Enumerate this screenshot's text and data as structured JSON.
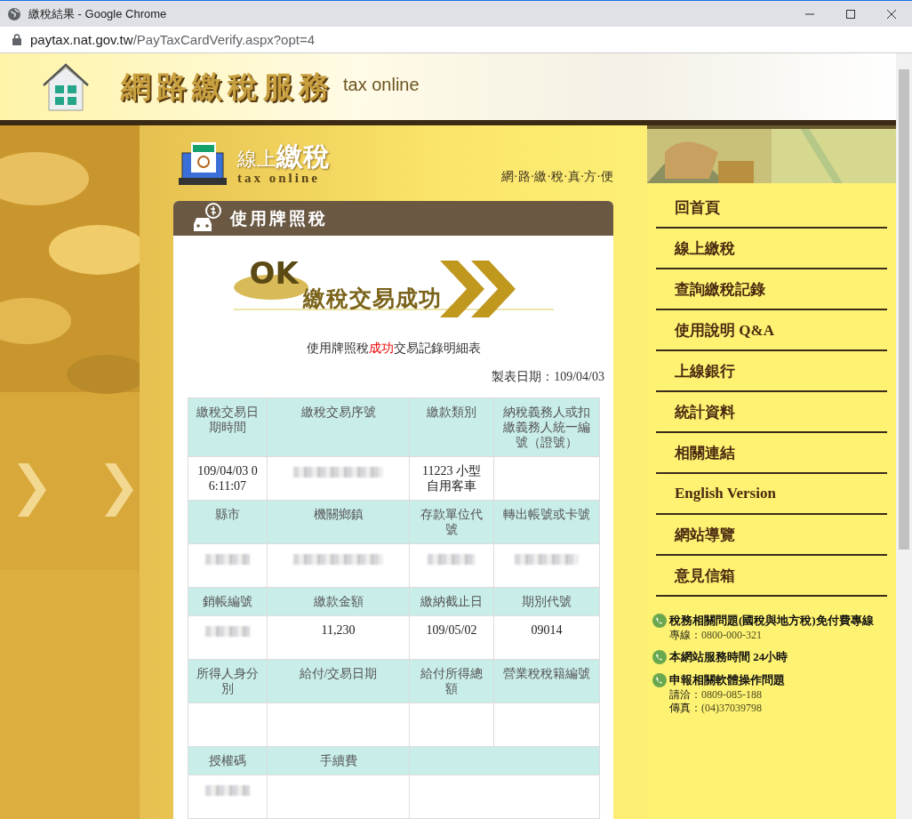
{
  "window": {
    "title": "繳稅結果 - Google Chrome",
    "url_host": "paytax.nat.gov.tw",
    "url_path": "/PayTaxCardVerify.aspx?opt=4"
  },
  "header": {
    "title": "網路繳稅服務",
    "subtitle": "tax online"
  },
  "section": {
    "title_small": "線上",
    "title_large": "繳稅",
    "subtitle": "tax online",
    "slogan": "網·路·繳·稅·真·方·便"
  },
  "panel": {
    "title": "使用牌照稅",
    "ok_badge": "OK",
    "result": "繳稅交易成功",
    "caption": [
      {
        "text": "使用牌照稅",
        "emphasis": false
      },
      {
        "text": "成功",
        "emphasis": true
      },
      {
        "text": "交易記錄明細表",
        "emphasis": false
      }
    ],
    "date_line": "製表日期：109/04/03"
  },
  "table": {
    "rows": [
      {
        "kind": "header",
        "cells": [
          {
            "text": "繳稅交易日期時間"
          },
          {
            "text": "繳稅交易序號"
          },
          {
            "text": "繳款類別"
          },
          {
            "text": "納稅義務人或扣繳義務人統一編號（證號）"
          }
        ]
      },
      {
        "kind": "data",
        "cells": [
          {
            "text": "109/04/03 06:11:07"
          },
          {
            "redacted": true
          },
          {
            "text": "11223 小型自用客車"
          },
          {}
        ]
      },
      {
        "kind": "header",
        "cells": [
          {
            "text": "縣市"
          },
          {
            "text": "機關鄉鎮"
          },
          {
            "text": "存款單位代號"
          },
          {
            "text": "轉出帳號或卡號"
          }
        ]
      },
      {
        "kind": "data",
        "cells": [
          {
            "redacted": true
          },
          {
            "redacted": true
          },
          {
            "redacted": true
          },
          {
            "redacted": true
          }
        ]
      },
      {
        "kind": "header",
        "cells": [
          {
            "text": "銷帳編號"
          },
          {
            "text": "繳款金額"
          },
          {
            "text": "繳納截止日"
          },
          {
            "text": "期別代號"
          }
        ]
      },
      {
        "kind": "data",
        "cells": [
          {
            "redacted": true
          },
          {
            "text": "11,230"
          },
          {
            "text": "109/05/02"
          },
          {
            "text": "09014"
          }
        ]
      },
      {
        "kind": "header",
        "cells": [
          {
            "text": "所得人身分別"
          },
          {
            "text": "給付/交易日期"
          },
          {
            "text": "給付所得總額"
          },
          {
            "text": "營業稅稅籍編號"
          }
        ]
      },
      {
        "kind": "data",
        "cells": [
          {},
          {},
          {},
          {}
        ]
      },
      {
        "kind": "header",
        "cells": [
          {
            "text": "授權碼"
          },
          {
            "text": "手續費"
          },
          {}
        ]
      },
      {
        "kind": "data",
        "cells": [
          {
            "redacted": true
          },
          {},
          {}
        ]
      }
    ]
  },
  "nav": {
    "items": [
      {
        "label": "回首頁"
      },
      {
        "label": "線上繳稅"
      },
      {
        "label": "查詢繳稅記錄"
      },
      {
        "label": "使用說明 Q&A"
      },
      {
        "label": "上線銀行"
      },
      {
        "label": "統計資料"
      },
      {
        "label": "相關連結"
      },
      {
        "label": "English Version"
      },
      {
        "label": "網站導覽"
      },
      {
        "label": "意見信箱"
      }
    ]
  },
  "contacts": [
    {
      "title": "稅務相關問題(國稅與地方稅)免付費專線",
      "lines": [
        {
          "label": "專線：",
          "value": "0800-000-321"
        }
      ]
    },
    {
      "title": "本網站服務時間 24小時"
    },
    {
      "title": "申報相關軟體操作問題",
      "lines": [
        {
          "label": "請洽：",
          "value": "0809-085-188"
        },
        {
          "label": "傳真：",
          "value": "(04)37039798"
        }
      ]
    }
  ]
}
